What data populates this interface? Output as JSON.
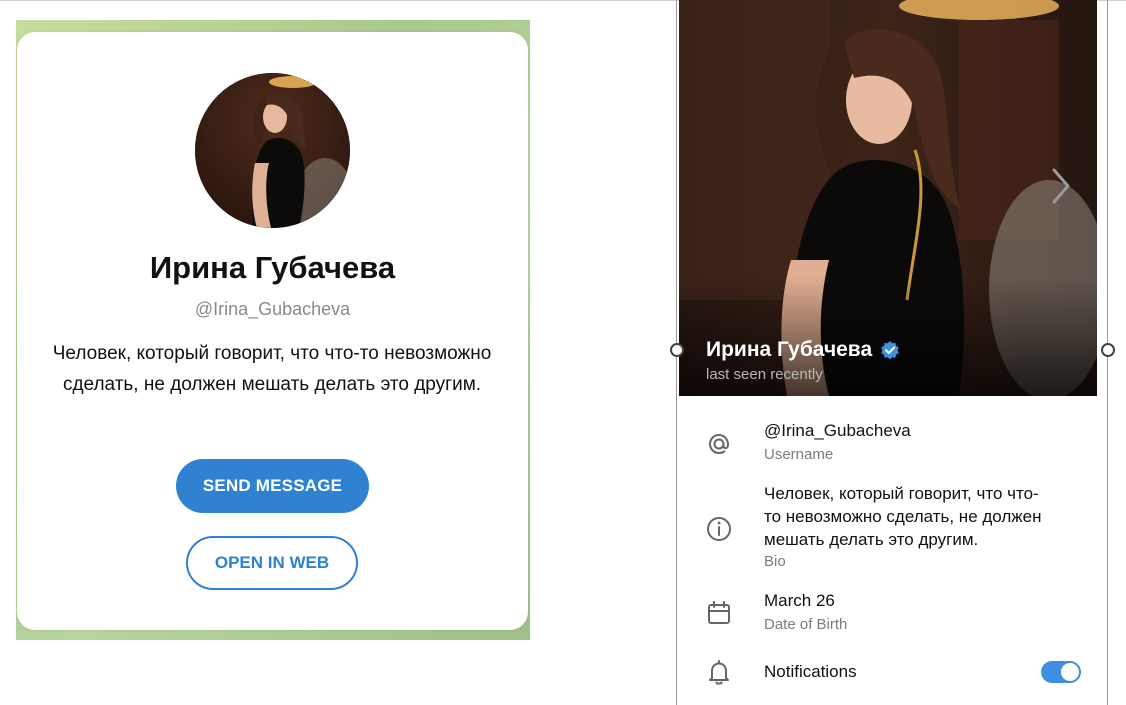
{
  "profile": {
    "name": "Ирина Губачева",
    "username": "@Irina_Gubacheva",
    "bio": "Человек, который говорит, что что-то невозможно сделать, не должен мешать делать это другим."
  },
  "card": {
    "send_message_label": "SEND MESSAGE",
    "open_in_web_label": "OPEN IN WEB"
  },
  "panel": {
    "status": "last seen recently",
    "username_label": "Username",
    "bio_lines": [
      "Человек, который говорит, что что-",
      "то невозможно сделать, не должен",
      "мешать делать это другим."
    ],
    "bio_label": "Bio",
    "birthday_value": "March 26",
    "birthday_label": "Date of Birth",
    "notifications_label": "Notifications",
    "notifications_enabled": true
  },
  "colors": {
    "accent": "#2e82cf",
    "toggle": "#3f8fe0",
    "verified": "#3f8fe0"
  },
  "icons": {
    "username": "at-sign-icon",
    "bio": "info-circle-icon",
    "birthday": "calendar-icon",
    "notifications": "bell-icon",
    "verified": "verified-badge-icon",
    "next": "chevron-right-icon"
  }
}
